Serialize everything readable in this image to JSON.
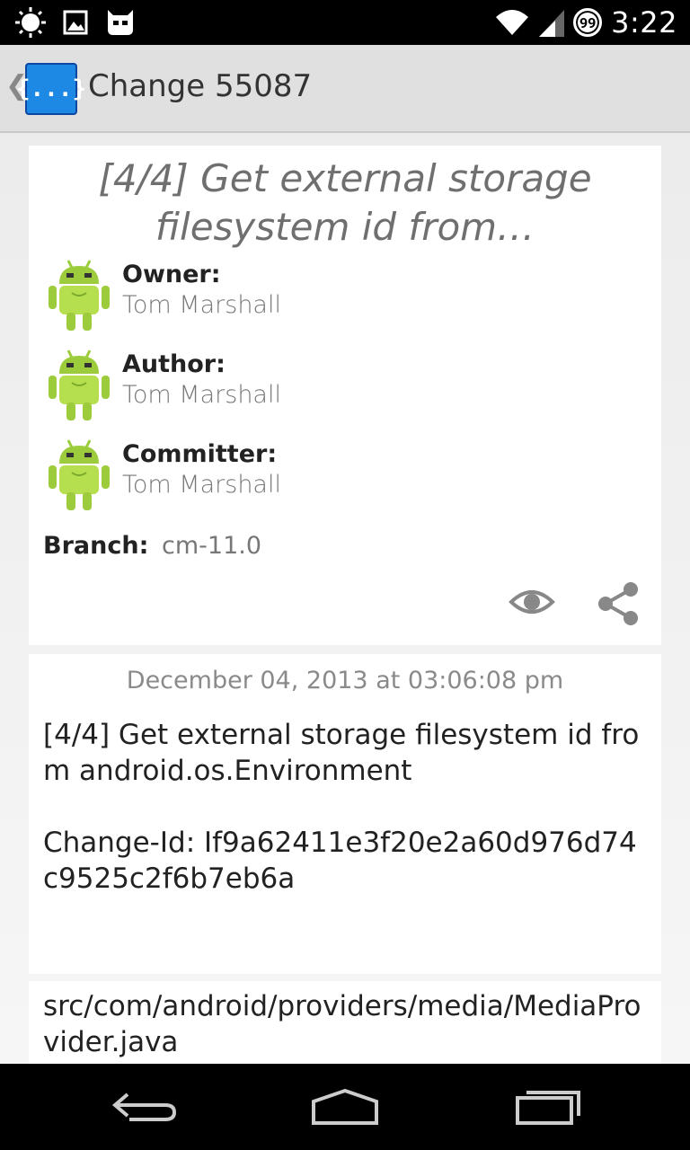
{
  "status_bar": {
    "time": "3:22",
    "notification_badge": "99",
    "icons": [
      "brightness-icon",
      "image-icon",
      "cyanogen-mascot-icon",
      "wifi-icon",
      "signal-icon"
    ]
  },
  "action_bar": {
    "title": "Change 55087",
    "app_icon_text": "{...}"
  },
  "change": {
    "subject": "[4/4] Get external storage filesystem id from…",
    "people": [
      {
        "label": "Owner:",
        "name": "Tom Marshall"
      },
      {
        "label": "Author:",
        "name": "Tom Marshall"
      },
      {
        "label": "Committer:",
        "name": "Tom Marshall"
      }
    ],
    "branch_label": "Branch:",
    "branch": "cm-11.0"
  },
  "commit": {
    "date": "December 04, 2013 at 03:06:08 pm",
    "message": "[4/4] Get external storage filesystem id from android.os.Environment\n\nChange-Id: If9a62411e3f20e2a60d976d74c9525c2f6b7eb6a"
  },
  "files": [
    {
      "path": "src/com/android/providers/media/MediaProvider.java"
    }
  ],
  "colors": {
    "droid_green": "#9ccc3c",
    "app_icon_blue": "#1e88e5"
  }
}
